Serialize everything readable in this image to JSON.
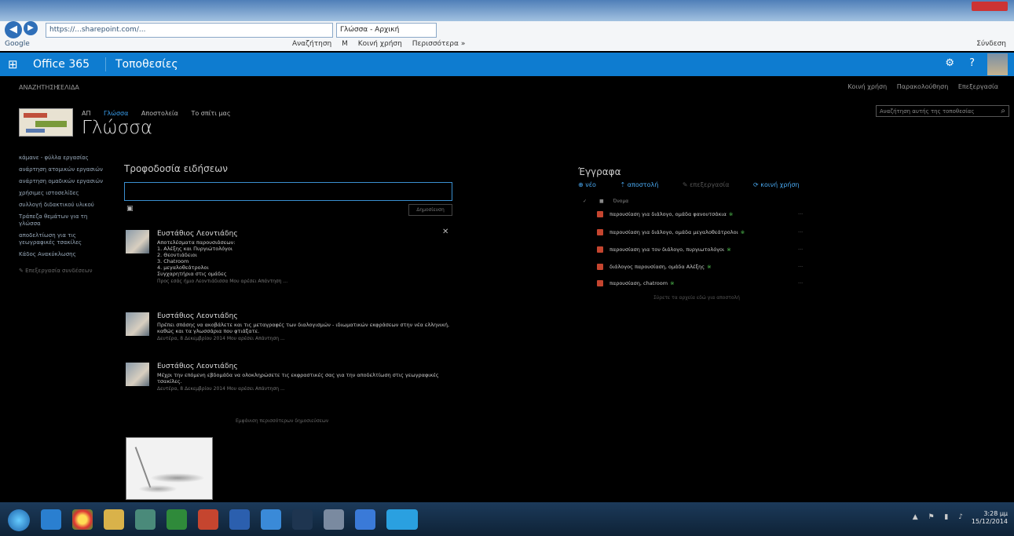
{
  "browser": {
    "url": "https://...sharepoint.com/...",
    "tab_title": "Γλώσσα - Αρχική",
    "google_label": "Google",
    "favorites": [
      "Αναζήτηση",
      "M",
      "Κοινή χρήση",
      "Περισσότερα »"
    ],
    "signin": "Σύνδεση"
  },
  "suite": {
    "o365": "Office 365",
    "sites": "Τοποθεσίες"
  },
  "ribbon": {
    "browse": "ΑΝΑΖΗΤΗΣΗ",
    "page": "ΣΕΛΙΔΑ",
    "share": "Κοινή χρήση",
    "follow": "Παρακολούθηση",
    "edit": "Επεξεργασία"
  },
  "site": {
    "title": "Γλώσσα",
    "search_placeholder": "Αναζήτηση αυτής της τοποθεσίας",
    "topnav": [
      {
        "label": "ΑΠ"
      },
      {
        "label": "Γλώσσα"
      },
      {
        "label": "Αποστολεία"
      },
      {
        "label": "Το σπίτι μας"
      }
    ]
  },
  "quicklaunch": {
    "items": [
      "κάμανε - φύλλα εργασίας",
      "ανάρτηση ατομικών εργασιών",
      "ανάρτηση ομαδικών εργασιών",
      "χρήσιμες ιστοσελίδες",
      "συλλογή διδακτικού υλικού",
      "Τράπεζα θεμάτων για τη γλώσσα",
      "αποδελτίωση για τις γεωγραφικές τσακίλες",
      "Κάδος Ανακύκλωσης"
    ],
    "edit_links": "Επεξεργασία συνδέσεων"
  },
  "newsfeed": {
    "title": "Τροφοδοσία ειδήσεων",
    "post_button": "Δημοσίευση",
    "more": "Εμφάνιση περισσότερων δημοσιεύσεων",
    "posts": [
      {
        "author": "Ευστάθιος Λεοντιάδης",
        "body": "Αποτελέσματα παρουσιάσεων:\n1. Αλέξης και Πυργιώτολόγοι\n2. Θεοντιάδειοι\n3. Chatroom\n4. μεγαλοθεάτρολοι\nΣυγχαρητήρια στις ομάδες",
        "meta": "Προς εσάς ήμιο Λεοντιάδισσα   Μου αρέσει   Απάντηση   ..."
      },
      {
        "author": "Ευστάθιος Λεοντιάδης",
        "body": "Πρέπει σπάσης να ακοβάλετε και τις μεταγραφές των διαλογισμών - ιδιωματικών εκφράσεων στην νέα ελληνική, καθώς και τα γλωσσάρια που φτιάξατε.",
        "meta": "Δευτέρα, 8 Δεκεμβρίου 2014   Μου αρέσει   Απάντηση   ..."
      },
      {
        "author": "Ευστάθιος Λεοντιάδης",
        "body": "Μέχρι την επόμενη εβδομάδα να ολοκληρώσετε τις εκφραστικές σας για την αποδελτίωση στις γεωγραφικές τσακίλες.",
        "meta": "Δευτέρα, 8 Δεκεμβρίου 2014   Μου αρέσει   Απάντηση   ..."
      }
    ]
  },
  "documents": {
    "title": "Έγγραφα",
    "cmd_new": "νέο",
    "cmd_upload": "αποστολή",
    "cmd_edit": "επεξεργασία",
    "cmd_share": "κοινή χρήση",
    "col_name": "Όνομα",
    "new_mark": "※",
    "items": [
      "παρουσίαση για διάλογο, ομάδα φανουτσάκια",
      "παρουσίαση για διάλογο, ομάδα μεγαλοθεάτρολοι",
      "παρουσίαση για τον διάλογο, πυργιωτολόγοι",
      "διάλογος παρουσίαση, ομάδα Αλέξης",
      "παρουσίαση, chatroom"
    ],
    "drop_hint": "Σύρετε τα αρχεία εδώ για αποστολή"
  },
  "taskbar": {
    "time": "3:28 μμ",
    "date": "15/12/2014"
  }
}
